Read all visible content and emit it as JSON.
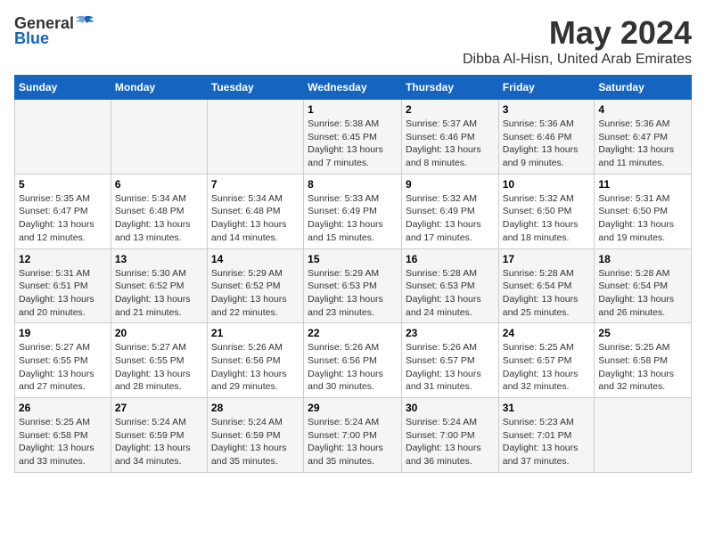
{
  "logo": {
    "general": "General",
    "blue": "Blue"
  },
  "title": "May 2024",
  "subtitle": "Dibba Al-Hisn, United Arab Emirates",
  "days_of_week": [
    "Sunday",
    "Monday",
    "Tuesday",
    "Wednesday",
    "Thursday",
    "Friday",
    "Saturday"
  ],
  "weeks": [
    [
      {
        "day": "",
        "info": ""
      },
      {
        "day": "",
        "info": ""
      },
      {
        "day": "",
        "info": ""
      },
      {
        "day": "1",
        "info": "Sunrise: 5:38 AM\nSunset: 6:45 PM\nDaylight: 13 hours\nand 7 minutes."
      },
      {
        "day": "2",
        "info": "Sunrise: 5:37 AM\nSunset: 6:46 PM\nDaylight: 13 hours\nand 8 minutes."
      },
      {
        "day": "3",
        "info": "Sunrise: 5:36 AM\nSunset: 6:46 PM\nDaylight: 13 hours\nand 9 minutes."
      },
      {
        "day": "4",
        "info": "Sunrise: 5:36 AM\nSunset: 6:47 PM\nDaylight: 13 hours\nand 11 minutes."
      }
    ],
    [
      {
        "day": "5",
        "info": "Sunrise: 5:35 AM\nSunset: 6:47 PM\nDaylight: 13 hours\nand 12 minutes."
      },
      {
        "day": "6",
        "info": "Sunrise: 5:34 AM\nSunset: 6:48 PM\nDaylight: 13 hours\nand 13 minutes."
      },
      {
        "day": "7",
        "info": "Sunrise: 5:34 AM\nSunset: 6:48 PM\nDaylight: 13 hours\nand 14 minutes."
      },
      {
        "day": "8",
        "info": "Sunrise: 5:33 AM\nSunset: 6:49 PM\nDaylight: 13 hours\nand 15 minutes."
      },
      {
        "day": "9",
        "info": "Sunrise: 5:32 AM\nSunset: 6:49 PM\nDaylight: 13 hours\nand 17 minutes."
      },
      {
        "day": "10",
        "info": "Sunrise: 5:32 AM\nSunset: 6:50 PM\nDaylight: 13 hours\nand 18 minutes."
      },
      {
        "day": "11",
        "info": "Sunrise: 5:31 AM\nSunset: 6:50 PM\nDaylight: 13 hours\nand 19 minutes."
      }
    ],
    [
      {
        "day": "12",
        "info": "Sunrise: 5:31 AM\nSunset: 6:51 PM\nDaylight: 13 hours\nand 20 minutes."
      },
      {
        "day": "13",
        "info": "Sunrise: 5:30 AM\nSunset: 6:52 PM\nDaylight: 13 hours\nand 21 minutes."
      },
      {
        "day": "14",
        "info": "Sunrise: 5:29 AM\nSunset: 6:52 PM\nDaylight: 13 hours\nand 22 minutes."
      },
      {
        "day": "15",
        "info": "Sunrise: 5:29 AM\nSunset: 6:53 PM\nDaylight: 13 hours\nand 23 minutes."
      },
      {
        "day": "16",
        "info": "Sunrise: 5:28 AM\nSunset: 6:53 PM\nDaylight: 13 hours\nand 24 minutes."
      },
      {
        "day": "17",
        "info": "Sunrise: 5:28 AM\nSunset: 6:54 PM\nDaylight: 13 hours\nand 25 minutes."
      },
      {
        "day": "18",
        "info": "Sunrise: 5:28 AM\nSunset: 6:54 PM\nDaylight: 13 hours\nand 26 minutes."
      }
    ],
    [
      {
        "day": "19",
        "info": "Sunrise: 5:27 AM\nSunset: 6:55 PM\nDaylight: 13 hours\nand 27 minutes."
      },
      {
        "day": "20",
        "info": "Sunrise: 5:27 AM\nSunset: 6:55 PM\nDaylight: 13 hours\nand 28 minutes."
      },
      {
        "day": "21",
        "info": "Sunrise: 5:26 AM\nSunset: 6:56 PM\nDaylight: 13 hours\nand 29 minutes."
      },
      {
        "day": "22",
        "info": "Sunrise: 5:26 AM\nSunset: 6:56 PM\nDaylight: 13 hours\nand 30 minutes."
      },
      {
        "day": "23",
        "info": "Sunrise: 5:26 AM\nSunset: 6:57 PM\nDaylight: 13 hours\nand 31 minutes."
      },
      {
        "day": "24",
        "info": "Sunrise: 5:25 AM\nSunset: 6:57 PM\nDaylight: 13 hours\nand 32 minutes."
      },
      {
        "day": "25",
        "info": "Sunrise: 5:25 AM\nSunset: 6:58 PM\nDaylight: 13 hours\nand 32 minutes."
      }
    ],
    [
      {
        "day": "26",
        "info": "Sunrise: 5:25 AM\nSunset: 6:58 PM\nDaylight: 13 hours\nand 33 minutes."
      },
      {
        "day": "27",
        "info": "Sunrise: 5:24 AM\nSunset: 6:59 PM\nDaylight: 13 hours\nand 34 minutes."
      },
      {
        "day": "28",
        "info": "Sunrise: 5:24 AM\nSunset: 6:59 PM\nDaylight: 13 hours\nand 35 minutes."
      },
      {
        "day": "29",
        "info": "Sunrise: 5:24 AM\nSunset: 7:00 PM\nDaylight: 13 hours\nand 35 minutes."
      },
      {
        "day": "30",
        "info": "Sunrise: 5:24 AM\nSunset: 7:00 PM\nDaylight: 13 hours\nand 36 minutes."
      },
      {
        "day": "31",
        "info": "Sunrise: 5:23 AM\nSunset: 7:01 PM\nDaylight: 13 hours\nand 37 minutes."
      },
      {
        "day": "",
        "info": ""
      }
    ]
  ]
}
